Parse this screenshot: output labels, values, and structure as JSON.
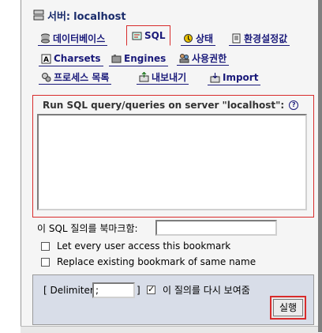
{
  "server": {
    "label": "서버:",
    "name": "localhost"
  },
  "tabs_row1": [
    {
      "label": "데이터베이스",
      "icon": "database-icon"
    },
    {
      "label": "SQL",
      "icon": "sql-icon",
      "active": true
    },
    {
      "label": "상태",
      "icon": "status-icon"
    },
    {
      "label": "환경설정값",
      "icon": "variables-icon"
    }
  ],
  "tabs_row2": [
    {
      "label": "Charsets",
      "icon": "charsets-icon"
    },
    {
      "label": "Engines",
      "icon": "engines-icon"
    },
    {
      "label": "사용권한",
      "icon": "privileges-icon"
    }
  ],
  "tabs_row3": [
    {
      "label": "프로세스 목록",
      "icon": "processes-icon"
    },
    {
      "label": "내보내기",
      "icon": "export-icon"
    },
    {
      "label": "Import",
      "icon": "import-icon"
    }
  ],
  "query": {
    "legend": "Run SQL query/queries on server \"localhost\":",
    "value": ""
  },
  "bookmark": {
    "label": "이 SQL 질의를 북마크함:",
    "value": "",
    "public_label": "Let every user access this bookmark",
    "replace_label": "Replace existing bookmark of same name"
  },
  "delimiter": {
    "label_start": "[ Delimiter",
    "value": ";",
    "label_end": "]"
  },
  "show_again": {
    "label": "이 질의를 다시 보여줌",
    "checked": true
  },
  "go_label": "실행"
}
